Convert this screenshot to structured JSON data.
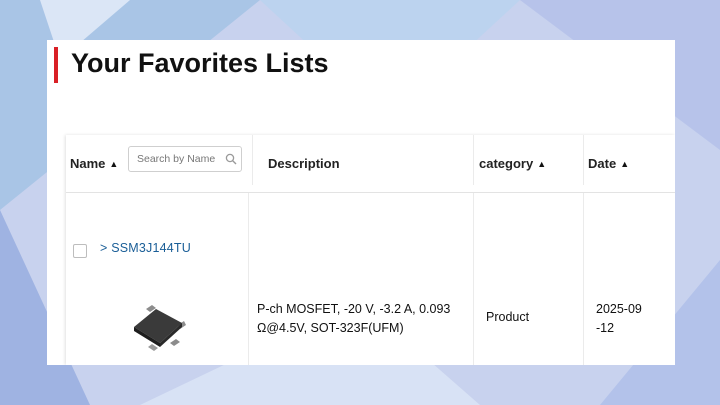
{
  "page": {
    "title": "Your Favorites Lists"
  },
  "colors": {
    "accent": "#d92026",
    "link": "#1a5e97",
    "background": "#c9d3ee"
  },
  "table": {
    "columns": {
      "name": {
        "label": "Name",
        "sort": "ascending"
      },
      "description": {
        "label": "Description"
      },
      "category": {
        "label": "category",
        "sort": "ascending"
      },
      "date": {
        "label": "Date",
        "sort": "ascending"
      }
    },
    "search": {
      "placeholder": "Search by Name",
      "value": "",
      "icon": "search-icon"
    },
    "sort_glyph": "▲",
    "rows": [
      {
        "checked": false,
        "link_prefix": ">",
        "name": "SSM3J144TU",
        "image_icon": "chip-package-icon",
        "description": "P-ch MOSFET, -20 V, -3.2 A, 0.093 Ω@4.5V, SOT-323F(UFM)",
        "category": "Product",
        "date": "2025-09-12"
      }
    ]
  }
}
